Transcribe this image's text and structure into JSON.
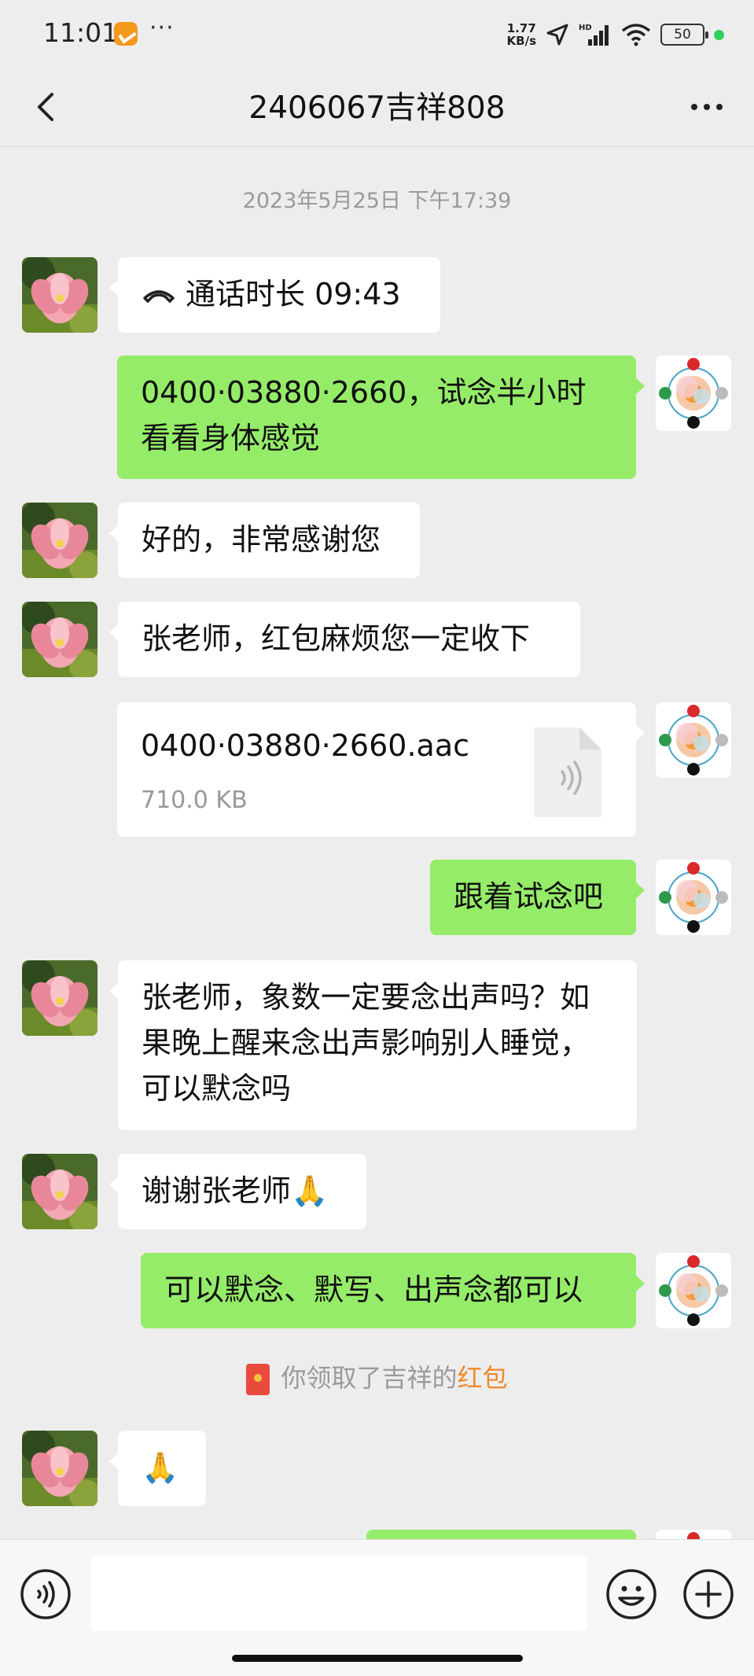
{
  "status_bar": {
    "time": "11:01",
    "more": "···",
    "net_speed": "1.77",
    "net_unit": "KB/s",
    "signal_label": "HD",
    "battery": "50"
  },
  "navbar": {
    "title": "2406067吉祥808"
  },
  "chat": {
    "timestamp": "2023年5月25日 下午17:39",
    "messages": [
      {
        "type": "call",
        "text": "通话时长 09:43"
      },
      {
        "text": "0400·03880·2660，试念半小时看看身体感觉"
      },
      {
        "text": "好的，非常感谢您"
      },
      {
        "text": "张老师，红包麻烦您一定收下"
      },
      {
        "type": "file",
        "name": "0400·03880·2660.aac",
        "size": "710.0 KB"
      },
      {
        "text": "跟着试念吧"
      },
      {
        "text": "张老师，象数一定要念出声吗？如果晚上醒来念出声影响别人睡觉，可以默念吗"
      },
      {
        "text": "谢谢张老师🙏"
      },
      {
        "text": "可以默念、默写、出声念都可以"
      },
      {
        "text": "🙏"
      }
    ],
    "redpacket_notice": {
      "prefix": "你领取了吉祥的",
      "link": "红包"
    }
  },
  "input_bar": {
    "placeholder": ""
  },
  "colors": {
    "background": "#ededed",
    "outgoing_bubble": "#95ec69",
    "incoming_bubble": "#ffffff",
    "redpacket_link": "#f08a2a"
  }
}
